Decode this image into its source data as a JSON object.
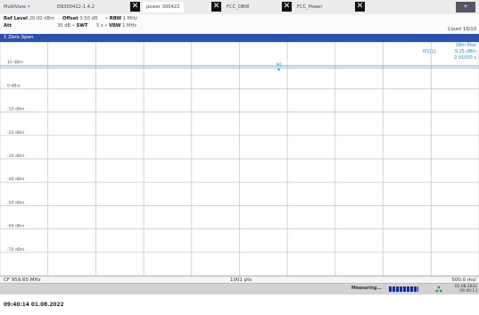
{
  "tabs": {
    "multiview_label": "MultiView",
    "items": [
      {
        "label": "EN300422-1.4.2",
        "active": false
      },
      {
        "label": "power 300422",
        "active": true
      },
      {
        "label": "FCC_OBW",
        "active": false
      },
      {
        "label": "FCC_Power",
        "active": false
      }
    ],
    "close_glyph": "✕",
    "corner_glyph": "+"
  },
  "settings": {
    "ref_level_label": "Ref Level",
    "ref_level_value": "20.00 dBm",
    "offset_label": "Offset",
    "offset_value": "0.50 dB",
    "rbw_label": "RBW",
    "rbw_value": "1 MHz",
    "att_label": "Att",
    "att_value": "30 dB",
    "swt_label": "SWT",
    "swt_value": "5 s",
    "vbw_label": "VBW",
    "vbw_value": "1 MHz",
    "count": "Count 10/10"
  },
  "diagram": {
    "title": "1 Zero Span",
    "trace_mode": "1Rm Max",
    "marker_label": "M1[1]",
    "marker_value": "9.25 dBm",
    "marker_time": "2.91000 s",
    "marker_tag": "M1"
  },
  "chart_data": {
    "type": "line",
    "y_tick_labels": [
      "10 dBm",
      "0 dBm",
      "-10 dBm",
      "-20 dBm",
      "-30 dBm",
      "-40 dBm",
      "-50 dBm",
      "-60 dBm",
      "-70 dBm"
    ],
    "ylim": [
      -80,
      20
    ],
    "xlim": [
      0,
      5
    ],
    "x_unit": "s",
    "grid": true,
    "series": [
      {
        "color": "#3a8ee6",
        "values": [
          9.25,
          9.25
        ]
      }
    ],
    "markers": [
      {
        "label": "M1",
        "x": 2.91,
        "y": 9.25
      }
    ]
  },
  "footer": {
    "cf": "CF 959.65 MHz",
    "points": "1001 pts",
    "span": "500.0 ms/"
  },
  "status": {
    "measuring": "Measuring...",
    "date_small": "01.08.2022",
    "time_small": "09:40:13"
  },
  "timestamp": "09:40:14 01.08.2022",
  "colors": {
    "titlebar": "#2f4fb0",
    "trace": "#3a8ee6",
    "marker_text": "#2a8fe0",
    "progress": "#1c2e8c"
  }
}
